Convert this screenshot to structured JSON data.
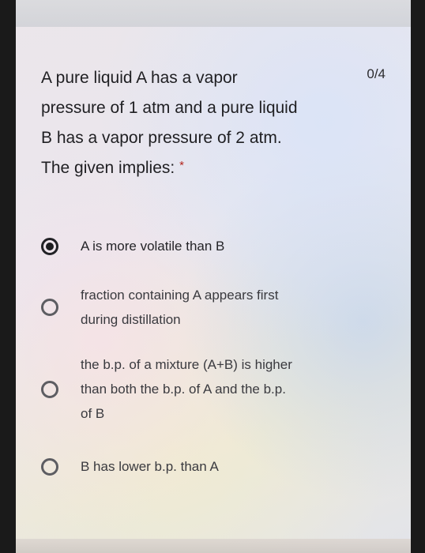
{
  "question": {
    "text_lines": [
      "A pure liquid A has a vapor",
      "pressure of 1 atm and a pure liquid",
      "B has a vapor pressure of 2 atm.",
      "The given implies:"
    ],
    "required_mark": "*",
    "score": "0/4"
  },
  "options": [
    {
      "label_lines": [
        "A is more volatile than B"
      ],
      "selected": true
    },
    {
      "label_lines": [
        "fraction containing A appears first",
        "during distillation"
      ],
      "selected": false
    },
    {
      "label_lines": [
        "the b.p. of a mixture (A+B) is higher",
        "than both the b.p. of A and the b.p.",
        "of B"
      ],
      "selected": false
    },
    {
      "label_lines": [
        "B has lower b.p. than A"
      ],
      "selected": false
    }
  ],
  "colors": {
    "text": "#1f1f22",
    "required": "#b3261e",
    "radio_border": "#5d5d62"
  }
}
